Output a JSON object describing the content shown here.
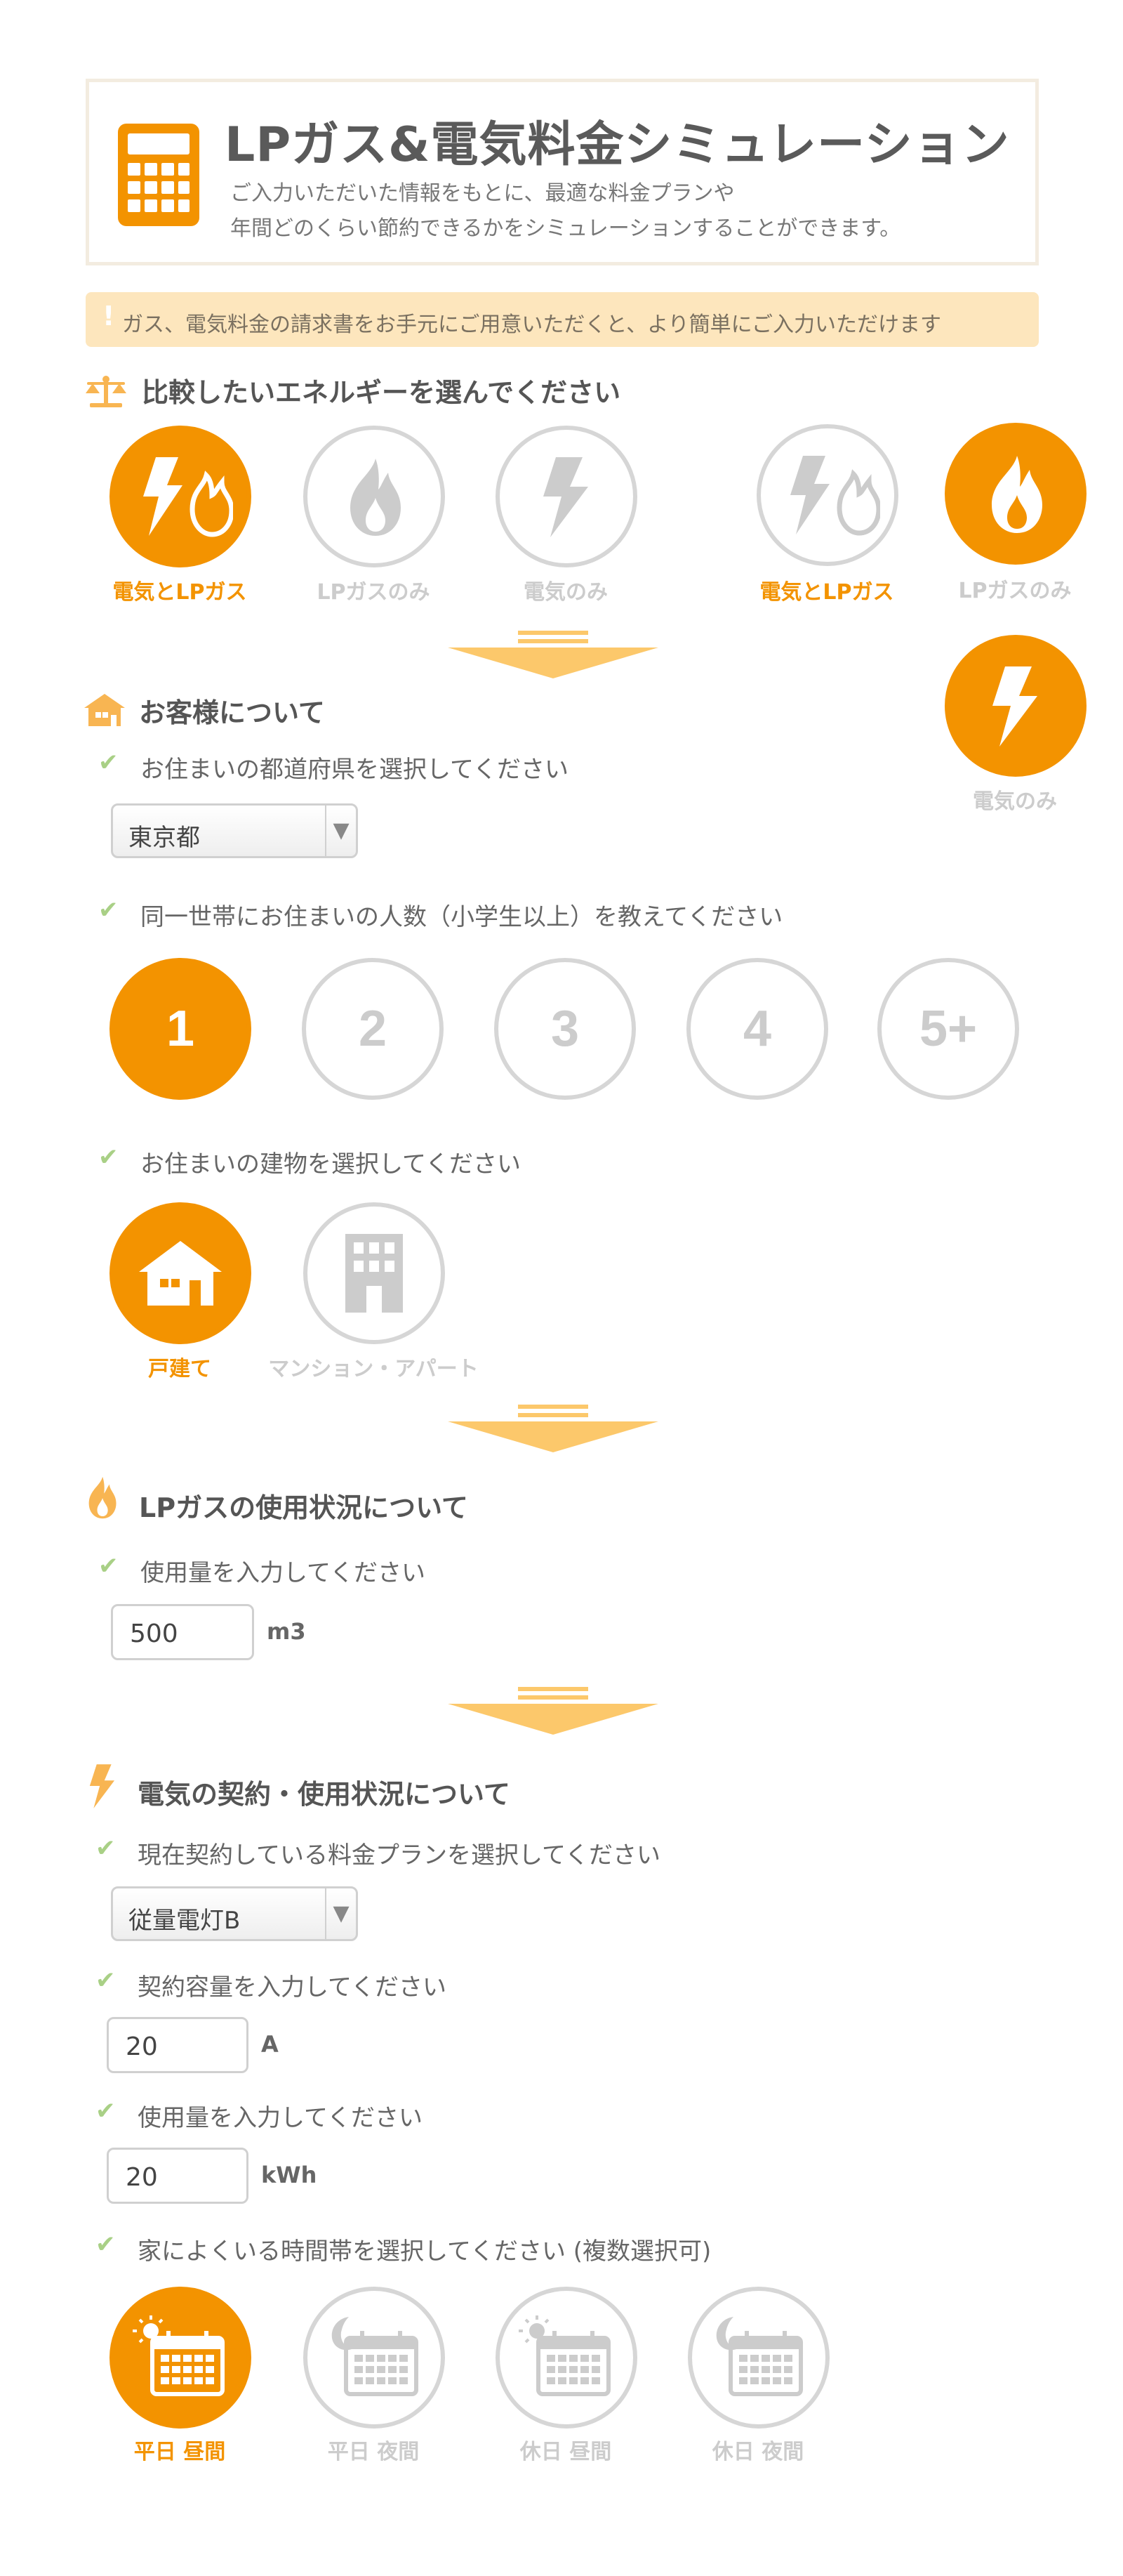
{
  "header": {
    "title": "LPガス&電気料金シミュレーション",
    "desc_line1": "ご入力いただいた情報をもとに、最適な料金プランや",
    "desc_line2": "年間どのくらい節約できるかをシミュレーションすることができます。"
  },
  "notice": {
    "mark": "!",
    "text": "ガス、電気料金の請求書をお手元にご用意いただくと、より簡単にご入力いただけます"
  },
  "energy": {
    "heading": "比較したいエネルギーを選んでください",
    "options": [
      {
        "label": "電気とLPガス",
        "selected": true
      },
      {
        "label": "LPガスのみ",
        "selected": false
      },
      {
        "label": "電気のみ",
        "selected": false
      }
    ],
    "hover_examples": [
      {
        "label": "電気とLPガス"
      },
      {
        "label": "LPガスのみ"
      },
      {
        "label": "電気のみ"
      }
    ]
  },
  "customer": {
    "heading": "お客様について",
    "prefecture_label": "お住まいの都道府県を選択してください",
    "prefecture_value": "東京都",
    "residents_label": "同一世帯にお住まいの人数（小学生以上）を教えてください",
    "residents_options": [
      "1",
      "2",
      "3",
      "4",
      "5+"
    ],
    "residents_selected": "1",
    "building_label": "お住まいの建物を選択してください",
    "building_options": [
      {
        "label": "戸建て",
        "selected": true
      },
      {
        "label": "マンション・アパート",
        "selected": false
      }
    ]
  },
  "gas": {
    "heading": "LPガスの使用状況について",
    "usage_label": "使用量を入力してください",
    "usage_value": "500",
    "usage_unit": "m3"
  },
  "electric": {
    "heading": "電気の契約・使用状況について",
    "plan_label": "現在契約している料金プランを選択してください",
    "plan_value": "従量電灯B",
    "capacity_label": "契約容量を入力してください",
    "capacity_value": "20",
    "capacity_unit": "A",
    "usage_label": "使用量を入力してください",
    "usage_value": "20",
    "usage_unit": "kWh",
    "time_label": "家によくいる時間帯を選択してください (複数選択可)",
    "time_options": [
      {
        "label": "平日 昼間",
        "selected": true
      },
      {
        "label": "平日 夜間",
        "selected": false
      },
      {
        "label": "休日 昼間",
        "selected": false
      },
      {
        "label": "休日 夜間",
        "selected": false
      }
    ]
  },
  "colors": {
    "accent": "#f39300",
    "inactive": "#d6d6d6",
    "notice_bg": "#fde6bd",
    "check": "#a9d086",
    "arrow": "#fcc86b"
  },
  "icons": {
    "app": "calculator-icon",
    "compare": "balance-scale-icon",
    "customer": "house-icon",
    "gas": "flame-icon",
    "electric": "lightning-icon",
    "check": "check-icon"
  }
}
